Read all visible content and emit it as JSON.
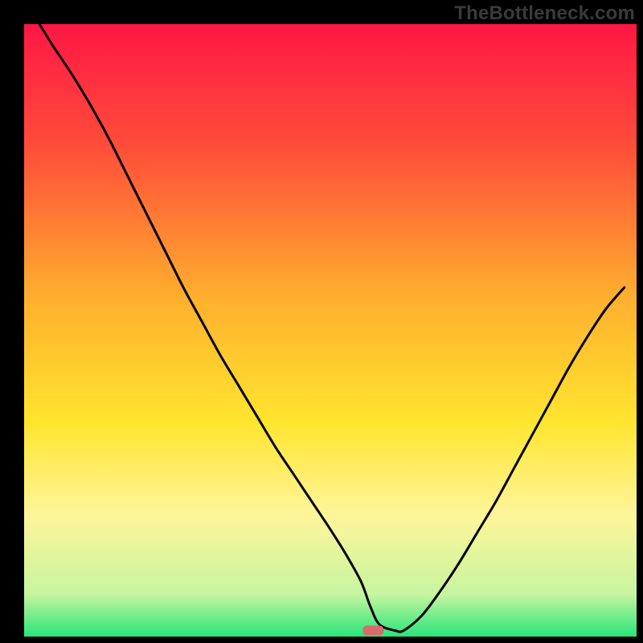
{
  "watermark": "TheBottleneck.com",
  "chart_data": {
    "type": "line",
    "title": "",
    "xlabel": "",
    "ylabel": "",
    "xlim": [
      0,
      100
    ],
    "ylim": [
      0,
      100
    ],
    "grid": false,
    "legend": false,
    "background_gradient": {
      "stops": [
        {
          "offset": 0.0,
          "color": "#ff1744"
        },
        {
          "offset": 0.2,
          "color": "#ff4d3a"
        },
        {
          "offset": 0.45,
          "color": "#ffb02e"
        },
        {
          "offset": 0.65,
          "color": "#ffe52e"
        },
        {
          "offset": 0.8,
          "color": "#fff59a"
        },
        {
          "offset": 0.93,
          "color": "#c8f5a0"
        },
        {
          "offset": 1.0,
          "color": "#28e57a"
        }
      ]
    },
    "marker": {
      "x": 57,
      "y": 1,
      "color": "#d86b6b"
    },
    "x": [
      2.5,
      5,
      8,
      11,
      14,
      17,
      20,
      23,
      26,
      29,
      32,
      35,
      38,
      41,
      44,
      47,
      50,
      52.5,
      55,
      56.5,
      58,
      60.5,
      62,
      65,
      68,
      71,
      74,
      77,
      80,
      83,
      86,
      89,
      92,
      95,
      98
    ],
    "y": [
      100,
      96,
      91.5,
      86.5,
      81,
      75,
      69,
      63,
      57,
      51.5,
      46,
      41,
      36,
      31,
      26.5,
      22,
      17.5,
      13.5,
      9,
      5,
      2,
      1,
      1,
      3.5,
      7.5,
      12,
      17,
      22,
      27.5,
      33,
      38.5,
      44,
      49,
      53.5,
      57
    ],
    "annotations": []
  }
}
